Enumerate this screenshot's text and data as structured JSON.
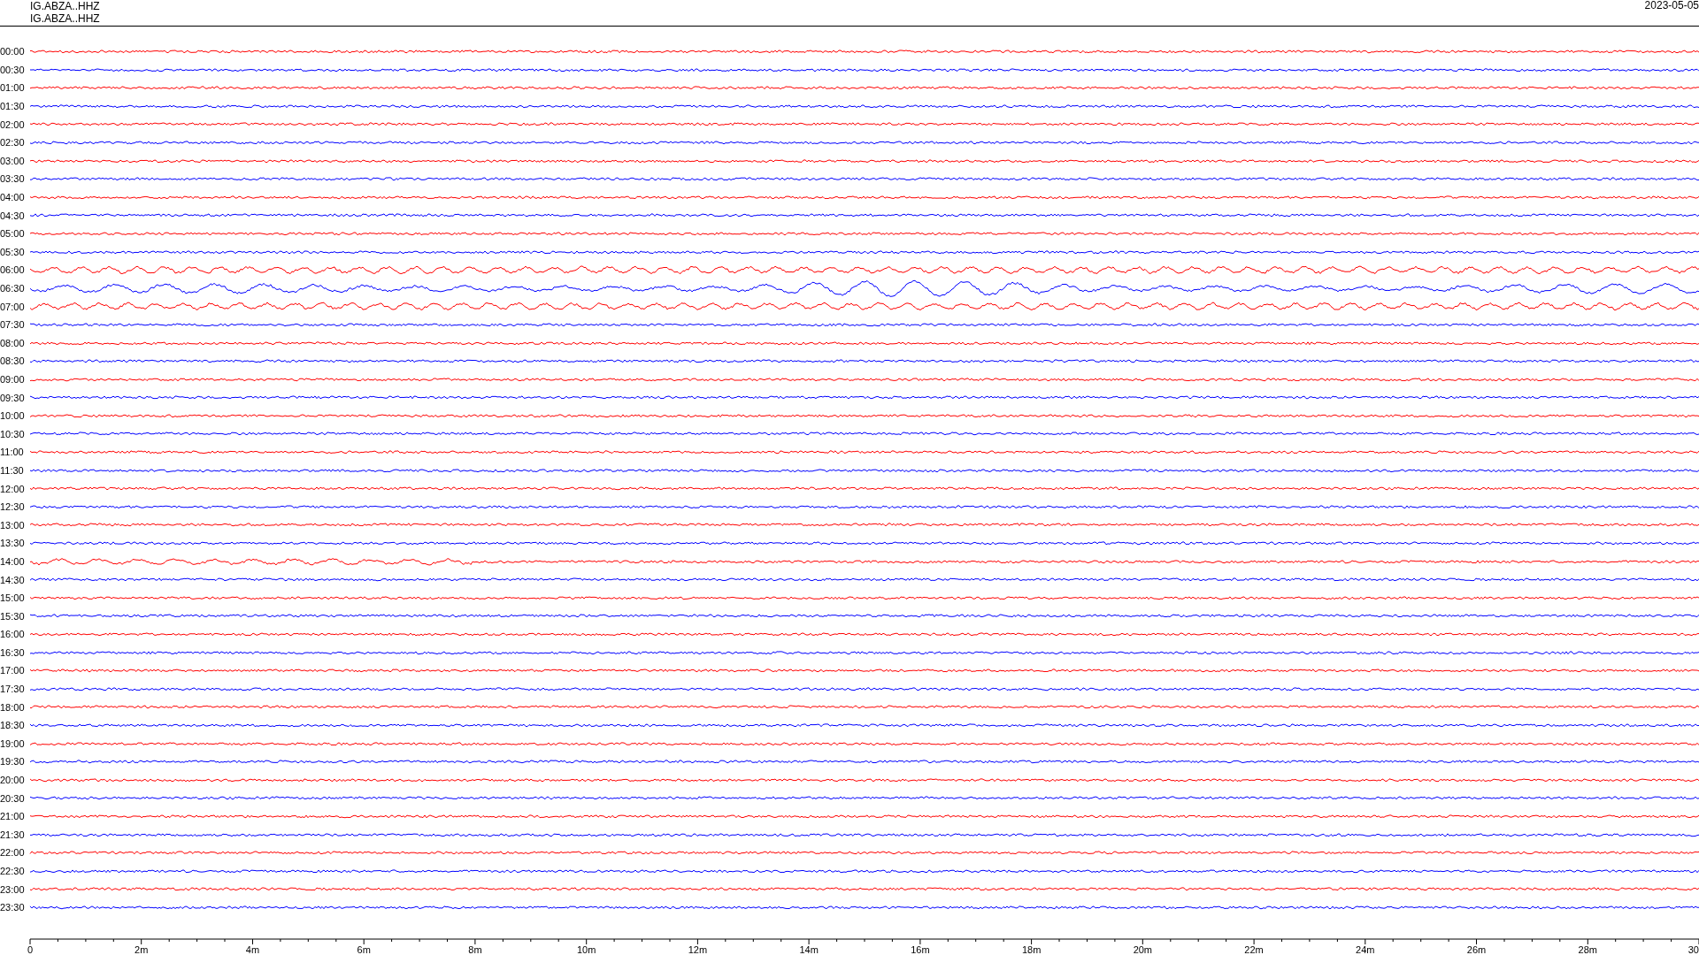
{
  "header": {
    "station_lines": [
      "IG.ABZA..HHZ",
      "IG.ABZA..HHZ"
    ],
    "date": "2023-05-05"
  },
  "traces": [
    {
      "time": "00:00",
      "color": "#ff0000"
    },
    {
      "time": "00:30",
      "color": "#0000ff"
    },
    {
      "time": "01:00",
      "color": "#ff0000"
    },
    {
      "time": "01:30",
      "color": "#0000ff"
    },
    {
      "time": "02:00",
      "color": "#ff0000"
    },
    {
      "time": "02:30",
      "color": "#0000ff"
    },
    {
      "time": "03:00",
      "color": "#ff0000"
    },
    {
      "time": "03:30",
      "color": "#0000ff"
    },
    {
      "time": "04:00",
      "color": "#ff0000"
    },
    {
      "time": "04:30",
      "color": "#0000ff"
    },
    {
      "time": "05:00",
      "color": "#ff0000"
    },
    {
      "time": "05:30",
      "color": "#0000ff"
    },
    {
      "time": "06:00",
      "color": "#ff0000"
    },
    {
      "time": "06:30",
      "color": "#0000ff"
    },
    {
      "time": "07:00",
      "color": "#ff0000"
    },
    {
      "time": "07:30",
      "color": "#0000ff"
    },
    {
      "time": "08:00",
      "color": "#ff0000"
    },
    {
      "time": "08:30",
      "color": "#0000ff"
    },
    {
      "time": "09:00",
      "color": "#ff0000"
    },
    {
      "time": "09:30",
      "color": "#0000ff"
    },
    {
      "time": "10:00",
      "color": "#ff0000"
    },
    {
      "time": "10:30",
      "color": "#0000ff"
    },
    {
      "time": "11:00",
      "color": "#ff0000"
    },
    {
      "time": "11:30",
      "color": "#0000ff"
    },
    {
      "time": "12:00",
      "color": "#ff0000"
    },
    {
      "time": "12:30",
      "color": "#0000ff"
    },
    {
      "time": "13:00",
      "color": "#ff0000"
    },
    {
      "time": "13:30",
      "color": "#0000ff"
    },
    {
      "time": "14:00",
      "color": "#ff0000"
    },
    {
      "time": "14:30",
      "color": "#0000ff"
    },
    {
      "time": "15:00",
      "color": "#ff0000"
    },
    {
      "time": "15:30",
      "color": "#0000ff"
    },
    {
      "time": "16:00",
      "color": "#ff0000"
    },
    {
      "time": "16:30",
      "color": "#0000ff"
    },
    {
      "time": "17:00",
      "color": "#ff0000"
    },
    {
      "time": "17:30",
      "color": "#0000ff"
    },
    {
      "time": "18:00",
      "color": "#ff0000"
    },
    {
      "time": "18:30",
      "color": "#0000ff"
    },
    {
      "time": "19:00",
      "color": "#ff0000"
    },
    {
      "time": "19:30",
      "color": "#0000ff"
    },
    {
      "time": "20:00",
      "color": "#ff0000"
    },
    {
      "time": "20:30",
      "color": "#0000ff"
    },
    {
      "time": "21:00",
      "color": "#ff0000"
    },
    {
      "time": "21:30",
      "color": "#0000ff"
    },
    {
      "time": "22:00",
      "color": "#ff0000"
    },
    {
      "time": "22:30",
      "color": "#0000ff"
    },
    {
      "time": "23:00",
      "color": "#ff0000"
    },
    {
      "time": "23:30",
      "color": "#0000ff"
    }
  ],
  "time_axis": {
    "labels": [
      "0",
      "2m",
      "4m",
      "6m",
      "8m",
      "10m",
      "12m",
      "14m",
      "16m",
      "18m",
      "20m",
      "22m",
      "24m",
      "26m",
      "28m",
      "30"
    ]
  }
}
